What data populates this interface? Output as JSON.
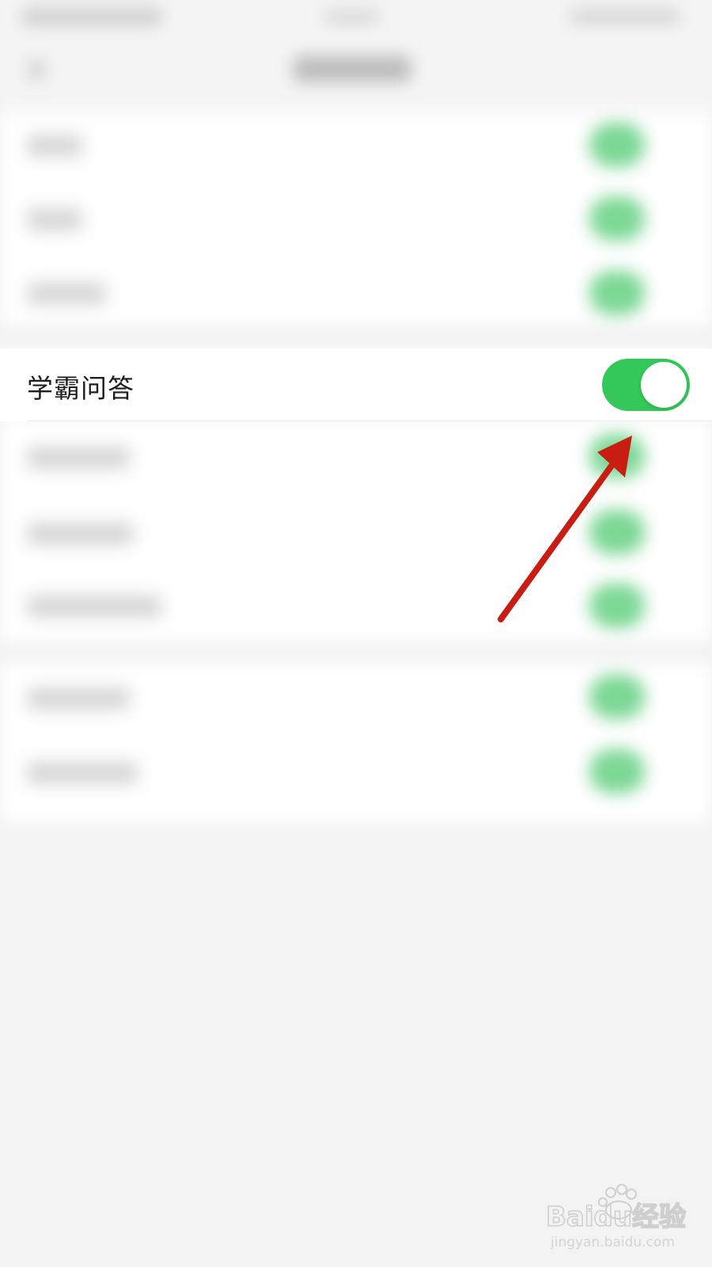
{
  "setting": {
    "label": "学霸问答",
    "enabled": true
  },
  "colors": {
    "toggle_on": "#34c759",
    "arrow": "#c81d12"
  },
  "watermark": {
    "brand": "Baidu经验",
    "url": "jingyan.baidu.com"
  }
}
